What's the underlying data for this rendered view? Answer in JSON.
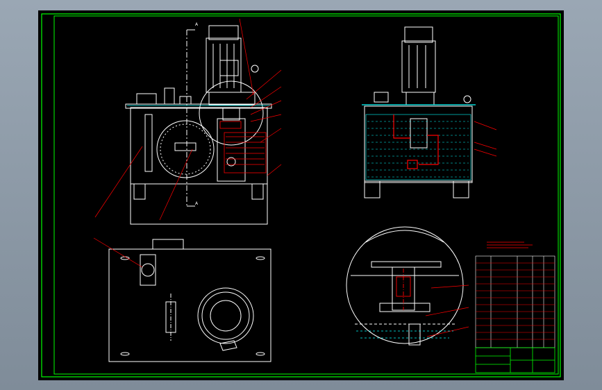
{
  "colors": {
    "background": "#000000",
    "frame": "#00ff00",
    "line": "#ffffff",
    "dimension": "#ff0000",
    "leader": "#ff0000",
    "hatch": "#00ffff",
    "title_text": "#ffffff"
  },
  "section_markers": {
    "top": "A",
    "bottom": "A"
  }
}
